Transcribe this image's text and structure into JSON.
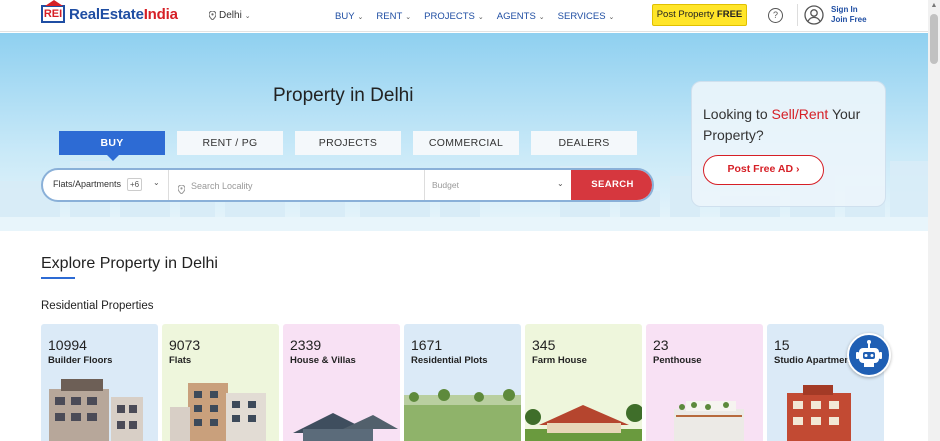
{
  "header": {
    "logo_badge": "REI",
    "logo_name_part1": "RealEstate",
    "logo_name_part2": "India",
    "city": "Delhi",
    "nav": [
      "BUY",
      "RENT",
      "PROJECTS",
      "AGENTS",
      "SERVICES"
    ],
    "post_property_prefix": "Post Property",
    "post_property_emph": "FREE",
    "help_label": "?",
    "sign_in": "Sign In",
    "join_free": "Join Free"
  },
  "hero": {
    "title": "Property in Delhi",
    "tabs": [
      "BUY",
      "RENT / PG",
      "PROJECTS",
      "COMMERCIAL",
      "DEALERS"
    ],
    "active_tab": "BUY",
    "search": {
      "property_type": "Flats/Apartments",
      "more_count": "+6",
      "locality_placeholder": "Search Locality",
      "budget_placeholder": "Budget",
      "search_label": "SEARCH"
    },
    "promo": {
      "line1_prefix": "Looking to ",
      "line1_emph": "Sell/Rent",
      "line1_suffix": " Your",
      "line2": "Property?",
      "button": "Post Free AD"
    }
  },
  "explore": {
    "title": "Explore Property in Delhi",
    "subtitle": "Residential Properties",
    "cards": [
      {
        "count": "10994",
        "name": "Builder Floors",
        "bg": "#dbeaf7"
      },
      {
        "count": "9073",
        "name": "Flats",
        "bg": "#eef6dc"
      },
      {
        "count": "2339",
        "name": "House & Villas",
        "bg": "#f8e1f4"
      },
      {
        "count": "1671",
        "name": "Residential Plots",
        "bg": "#dbeaf7"
      },
      {
        "count": "345",
        "name": "Farm House",
        "bg": "#eef6dc"
      },
      {
        "count": "23",
        "name": "Penthouse",
        "bg": "#f8e1f4"
      },
      {
        "count": "15",
        "name": "Studio Apartments",
        "bg": "#dbeaf7"
      }
    ]
  },
  "colors": {
    "brand_blue": "#1f4ea3",
    "brand_red": "#d61f26",
    "active_tab": "#2d6bd4",
    "post_btn": "#ffe529"
  }
}
